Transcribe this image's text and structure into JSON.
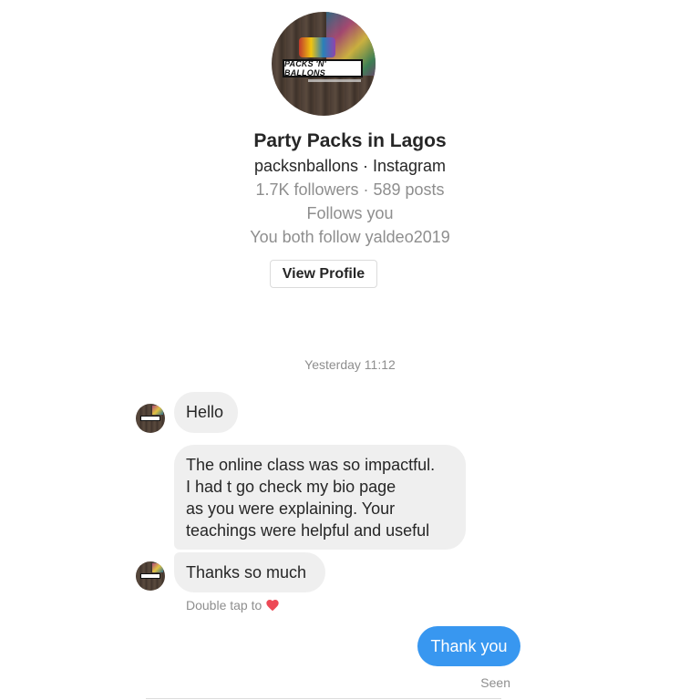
{
  "profile": {
    "avatar_icon": "brand-logo-avatar",
    "logo_text": "PACKS 'N' BALLONS",
    "name": "Party Packs in Lagos",
    "handle": "packsnballons · Instagram",
    "stats": "1.7K followers · 589 posts",
    "follows_you": "Follows you",
    "mutual": "You both follow yaldeo2019",
    "view_profile_label": "View Profile"
  },
  "thread": {
    "timestamp": "Yesterday 11:12",
    "messages_in": [
      {
        "text": "Hello"
      },
      {
        "lines": [
          "The online class was so impactful.",
          "I had t go check my bio page",
          "as you were explaining. Your",
          "teachings were helpful and useful"
        ]
      },
      {
        "text": "Thanks so much"
      }
    ],
    "double_tap_text": "Double tap to",
    "heart_icon": "heart-icon",
    "heart_color": "#ed4956",
    "message_out": "Thank you",
    "seen_label": "Seen"
  },
  "colors": {
    "outgoing_bubble": "#3897f0",
    "incoming_bubble": "#efefef",
    "muted_text": "#8e8e8e"
  }
}
